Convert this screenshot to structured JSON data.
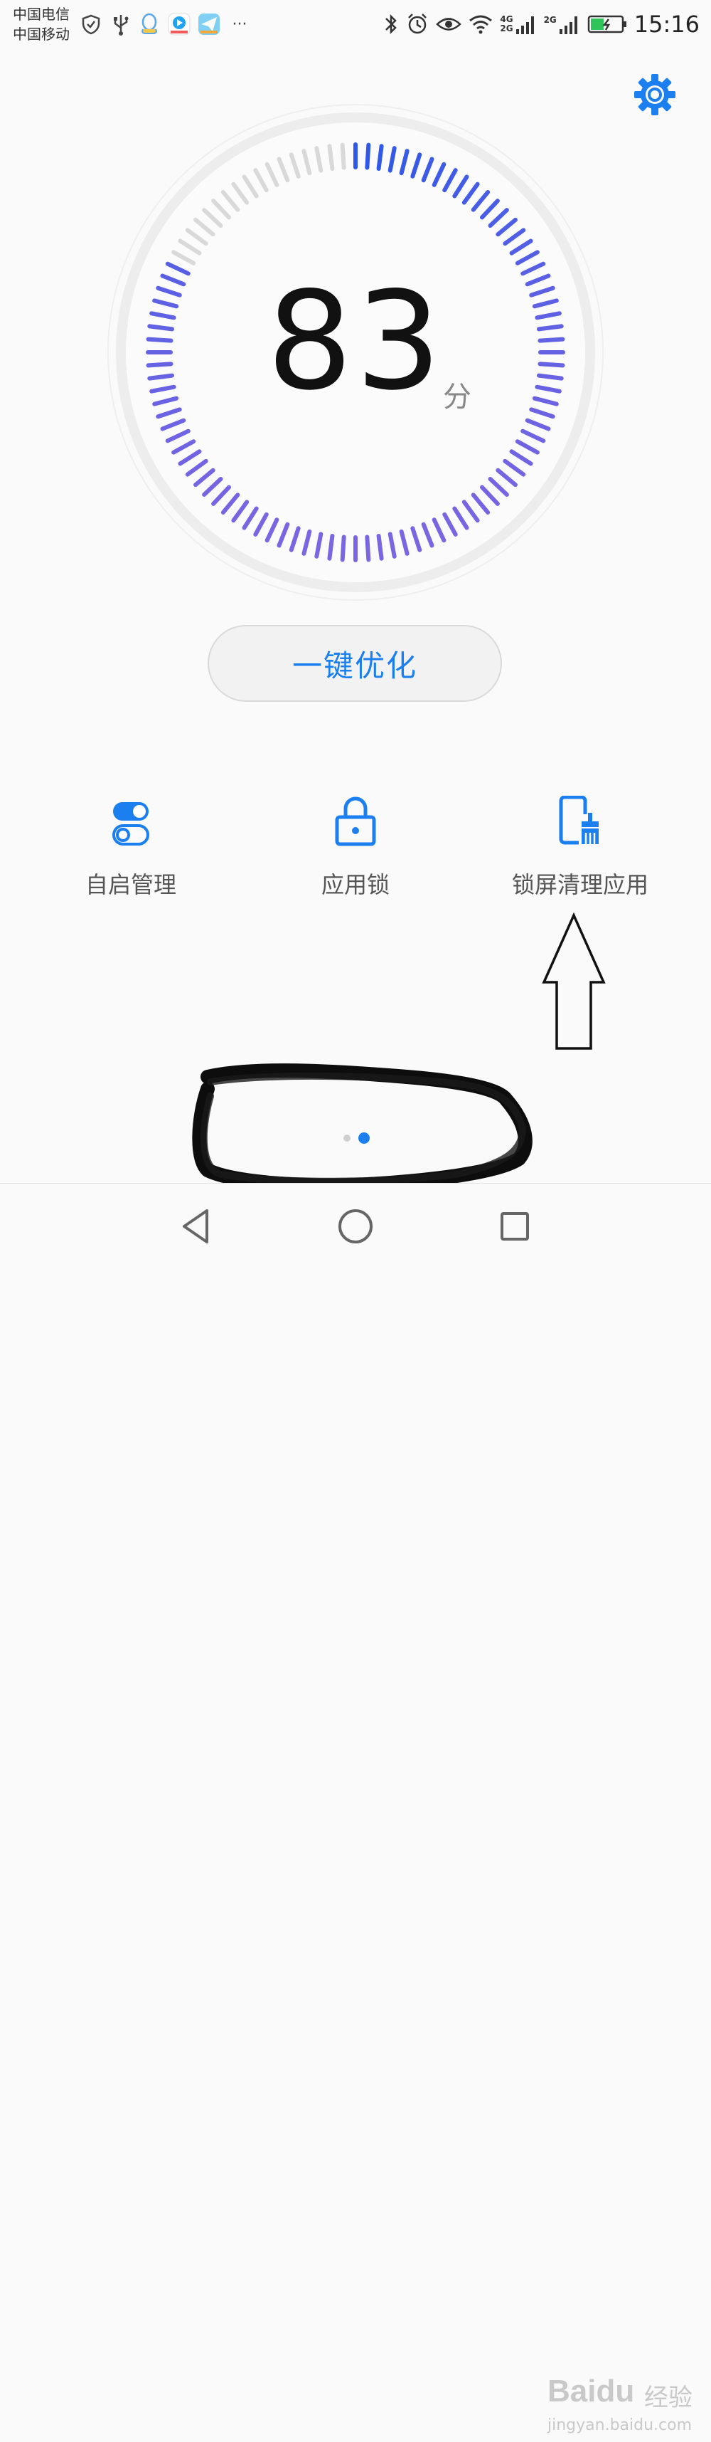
{
  "status_bar": {
    "carrier_1": "中国电信",
    "carrier_2": "中国移动",
    "network_1": "4G",
    "network_2": "2G",
    "network_3": "2G",
    "more": "···",
    "time": "15:16"
  },
  "score": {
    "value": "83",
    "unit": "分",
    "fraction": 0.83
  },
  "colors": {
    "accent": "#1b7ff0",
    "gauge_blue": "#2d58e8",
    "gauge_violet": "#7b66e2",
    "gauge_inactive": "#d9d9d9"
  },
  "optimize_button": {
    "label": "一键优化"
  },
  "features": [
    {
      "label": "自启管理",
      "icon": "toggle-switches-icon"
    },
    {
      "label": "应用锁",
      "icon": "padlock-icon"
    },
    {
      "label": "锁屏清理应用",
      "icon": "phone-broom-icon"
    }
  ],
  "pager": {
    "page_count": 2,
    "active_page": 2
  },
  "navigation": {
    "back": "back-triangle-icon",
    "home": "home-circle-icon",
    "recents": "recents-square-icon"
  },
  "watermark": {
    "logo": "Baidu",
    "cn": "经验",
    "url": "jingyan.baidu.com"
  }
}
